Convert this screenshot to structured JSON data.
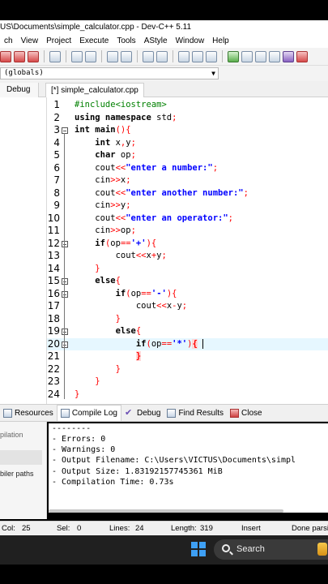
{
  "window": {
    "title": "US\\Documents\\simple_calculator.cpp - Dev-C++ 5.11"
  },
  "menu": [
    "ch",
    "View",
    "Project",
    "Execute",
    "Tools",
    "AStyle",
    "Window",
    "Help"
  ],
  "scope": {
    "value": "(globals)"
  },
  "tabs": {
    "left_tab": "Debug",
    "file_tab": "[*] simple_calculator.cpp"
  },
  "editor": {
    "lines": [
      {
        "n": "1",
        "html": "<span class=\"pp\">#include&lt;iostream&gt;</span>"
      },
      {
        "n": "2",
        "html": "<span class=\"kw\">using namespace</span> std<span class=\"op\">;</span>"
      },
      {
        "n": "3",
        "html": "<span class=\"kw\">int</span> <span class=\"kw\">main</span><span class=\"op\">(){</span>"
      },
      {
        "n": "4",
        "html": "    <span class=\"kw\">int</span> x<span class=\"op\">,</span>y<span class=\"op\">;</span>"
      },
      {
        "n": "5",
        "html": "    <span class=\"kw\">char</span> op<span class=\"op\">;</span>"
      },
      {
        "n": "6",
        "html": "    cout<span class=\"op\">&lt;&lt;</span><span class=\"str\">\"enter a number:\"</span><span class=\"op\">;</span>"
      },
      {
        "n": "7",
        "html": "    cin<span class=\"op\">&gt;&gt;</span>x<span class=\"op\">;</span>"
      },
      {
        "n": "8",
        "html": "    cout<span class=\"op\">&lt;&lt;</span><span class=\"str\">\"enter another number:\"</span><span class=\"op\">;</span>"
      },
      {
        "n": "9",
        "html": "    cin<span class=\"op\">&gt;&gt;</span>y<span class=\"op\">;</span>"
      },
      {
        "n": "10",
        "html": "    cout<span class=\"op\">&lt;&lt;</span><span class=\"str\">\"enter an operator:\"</span><span class=\"op\">;</span>"
      },
      {
        "n": "11",
        "html": "    cin<span class=\"op\">&gt;&gt;</span>op<span class=\"op\">;</span>"
      },
      {
        "n": "12",
        "html": "    <span class=\"kw\">if</span><span class=\"op\">(</span>op<span class=\"op\">==</span><span class=\"str\">'+'</span><span class=\"op\">){</span>"
      },
      {
        "n": "13",
        "html": "        cout<span class=\"op\">&lt;&lt;</span>x<span class=\"op\">+</span>y<span class=\"op\">;</span>"
      },
      {
        "n": "14",
        "html": "    <span class=\"op\">}</span>"
      },
      {
        "n": "15",
        "html": "    <span class=\"kw\">else</span><span class=\"op\">{</span>"
      },
      {
        "n": "16",
        "html": "        <span class=\"kw\">if</span><span class=\"op\">(</span>op<span class=\"op\">==</span><span class=\"str\">'-'</span><span class=\"op\">){</span>"
      },
      {
        "n": "17",
        "html": "            cout<span class=\"op\">&lt;&lt;</span>x<span class=\"op\">-</span>y<span class=\"op\">;</span>"
      },
      {
        "n": "18",
        "html": "        <span class=\"op\">}</span>"
      },
      {
        "n": "19",
        "html": "        <span class=\"kw\">else</span><span class=\"op\">{</span>"
      },
      {
        "n": "20",
        "html": "            <span class=\"kw\">if</span><span class=\"op\">(</span>op<span class=\"op\">==</span><span class=\"str\">'*'</span><span class=\"op\">)</span><span class=\"brace-hl\">{</span> <span class=\"caret\"></span>"
      },
      {
        "n": "21",
        "html": "            <span class=\"brace-hl\">}</span>"
      },
      {
        "n": "22",
        "html": "        <span class=\"op\">}</span>"
      },
      {
        "n": "23",
        "html": "    <span class=\"op\">}</span>"
      },
      {
        "n": "24",
        "html": "<span class=\"op\">}</span>"
      }
    ]
  },
  "bottom_tabs": [
    "Resources",
    "Compile Log",
    "Debug",
    "Find Results",
    "Close"
  ],
  "bottom_left": {
    "item1": "pilation",
    "item2": "biler paths"
  },
  "compile_log": [
    "--------",
    "- Errors: 0",
    "- Warnings: 0",
    "- Output Filename: C:\\Users\\VICTUS\\Documents\\simpl",
    "- Output Size: 1.83192157745361 MiB",
    "- Compilation Time: 0.73s"
  ],
  "status": {
    "col_label": "Col:",
    "col": "25",
    "sel_label": "Sel:",
    "sel": "0",
    "lines_label": "Lines:",
    "lines": "24",
    "length_label": "Length:",
    "length": "319",
    "mode": "Insert",
    "message": "Done parsi"
  },
  "taskbar": {
    "search": "Search"
  }
}
